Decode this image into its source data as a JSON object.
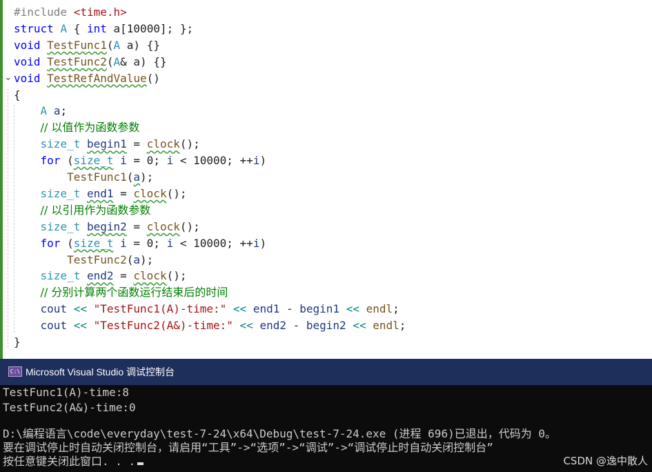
{
  "editor": {
    "lines": [
      {
        "tokens": [
          {
            "t": "#include ",
            "c": "pp"
          },
          {
            "t": "<time.h>",
            "c": "st"
          }
        ]
      },
      {
        "tokens": [
          {
            "t": "struct ",
            "c": "kw"
          },
          {
            "t": "A",
            "c": "ty"
          },
          {
            "t": " { "
          },
          {
            "t": "int",
            "c": "kw"
          },
          {
            "t": " a[10000]; };"
          }
        ]
      },
      {
        "tokens": [
          {
            "t": "void ",
            "c": "kw"
          },
          {
            "t": "TestFunc1",
            "c": "fn sq"
          },
          {
            "t": "("
          },
          {
            "t": "A",
            "c": "ty"
          },
          {
            "t": " a) {}"
          }
        ]
      },
      {
        "tokens": [
          {
            "t": "void ",
            "c": "kw"
          },
          {
            "t": "TestFunc2",
            "c": "fn sq"
          },
          {
            "t": "("
          },
          {
            "t": "A",
            "c": "ty"
          },
          {
            "t": "& a) {}"
          }
        ]
      },
      {
        "tokens": [
          {
            "t": "void ",
            "c": "kw"
          },
          {
            "t": "TestRefAndValue",
            "c": "fn sq"
          },
          {
            "t": "()"
          }
        ]
      },
      {
        "tokens": [
          {
            "t": "{"
          }
        ]
      },
      {
        "tokens": [
          {
            "t": "    "
          },
          {
            "t": "A",
            "c": "ty"
          },
          {
            "t": " "
          },
          {
            "t": "a",
            "c": "vr"
          },
          {
            "t": ";"
          }
        ]
      },
      {
        "tokens": [
          {
            "t": "    "
          },
          {
            "t": "// 以值作为函数参数",
            "c": "cm"
          }
        ]
      },
      {
        "tokens": [
          {
            "t": "    "
          },
          {
            "t": "size_t",
            "c": "ty"
          },
          {
            "t": " "
          },
          {
            "t": "begin1",
            "c": "vr sq"
          },
          {
            "t": " = "
          },
          {
            "t": "clock",
            "c": "fn sq"
          },
          {
            "t": "();"
          }
        ]
      },
      {
        "tokens": [
          {
            "t": "    "
          },
          {
            "t": "for",
            "c": "kw"
          },
          {
            "t": " ("
          },
          {
            "t": "size_t",
            "c": "ty sq"
          },
          {
            "t": " "
          },
          {
            "t": "i",
            "c": "vr"
          },
          {
            "t": " = 0; "
          },
          {
            "t": "i",
            "c": "vr"
          },
          {
            "t": " < 10000; ++"
          },
          {
            "t": "i",
            "c": "vr"
          },
          {
            "t": ")"
          }
        ]
      },
      {
        "tokens": [
          {
            "t": "        "
          },
          {
            "t": "TestFunc1",
            "c": "fn"
          },
          {
            "t": "("
          },
          {
            "t": "a",
            "c": "vr sq"
          },
          {
            "t": ");"
          }
        ]
      },
      {
        "tokens": [
          {
            "t": "    "
          },
          {
            "t": "size_t",
            "c": "ty"
          },
          {
            "t": " "
          },
          {
            "t": "end1",
            "c": "vr sq"
          },
          {
            "t": " = "
          },
          {
            "t": "clock",
            "c": "fn sq"
          },
          {
            "t": "();"
          }
        ]
      },
      {
        "tokens": [
          {
            "t": "    "
          },
          {
            "t": "// 以引用作为函数参数",
            "c": "cm"
          }
        ]
      },
      {
        "tokens": [
          {
            "t": "    "
          },
          {
            "t": "size_t",
            "c": "ty"
          },
          {
            "t": " "
          },
          {
            "t": "begin2",
            "c": "vr sq"
          },
          {
            "t": " = "
          },
          {
            "t": "clock",
            "c": "fn sq"
          },
          {
            "t": "();"
          }
        ]
      },
      {
        "tokens": [
          {
            "t": "    "
          },
          {
            "t": "for",
            "c": "kw"
          },
          {
            "t": " ("
          },
          {
            "t": "size_t",
            "c": "ty sq"
          },
          {
            "t": " "
          },
          {
            "t": "i",
            "c": "vr"
          },
          {
            "t": " = 0; "
          },
          {
            "t": "i",
            "c": "vr"
          },
          {
            "t": " < 10000; ++"
          },
          {
            "t": "i",
            "c": "vr"
          },
          {
            "t": ")"
          }
        ]
      },
      {
        "tokens": [
          {
            "t": "        "
          },
          {
            "t": "TestFunc2",
            "c": "fn"
          },
          {
            "t": "("
          },
          {
            "t": "a",
            "c": "vr"
          },
          {
            "t": ");"
          }
        ]
      },
      {
        "tokens": [
          {
            "t": "    "
          },
          {
            "t": "size_t",
            "c": "ty"
          },
          {
            "t": " "
          },
          {
            "t": "end2",
            "c": "vr sq"
          },
          {
            "t": " = "
          },
          {
            "t": "clock",
            "c": "fn sq"
          },
          {
            "t": "();"
          }
        ]
      },
      {
        "tokens": [
          {
            "t": "    "
          },
          {
            "t": "// 分别计算两个函数运行结束后的时间",
            "c": "cm"
          }
        ]
      },
      {
        "tokens": [
          {
            "t": "    "
          },
          {
            "t": "cout",
            "c": "vr"
          },
          {
            "t": " "
          },
          {
            "t": "<<",
            "c": "op"
          },
          {
            "t": " "
          },
          {
            "t": "\"TestFunc1(A)-time:\"",
            "c": "st"
          },
          {
            "t": " "
          },
          {
            "t": "<<",
            "c": "op"
          },
          {
            "t": " "
          },
          {
            "t": "end1",
            "c": "vr"
          },
          {
            "t": " - "
          },
          {
            "t": "begin1",
            "c": "vr"
          },
          {
            "t": " "
          },
          {
            "t": "<<",
            "c": "op"
          },
          {
            "t": " "
          },
          {
            "t": "endl",
            "c": "fn"
          },
          {
            "t": ";"
          }
        ]
      },
      {
        "tokens": [
          {
            "t": "    "
          },
          {
            "t": "cout",
            "c": "vr"
          },
          {
            "t": " "
          },
          {
            "t": "<<",
            "c": "op"
          },
          {
            "t": " "
          },
          {
            "t": "\"TestFunc2(A&)-time:\"",
            "c": "st"
          },
          {
            "t": " "
          },
          {
            "t": "<<",
            "c": "op"
          },
          {
            "t": " "
          },
          {
            "t": "end2",
            "c": "vr"
          },
          {
            "t": " - "
          },
          {
            "t": "begin2",
            "c": "vr"
          },
          {
            "t": " "
          },
          {
            "t": "<<",
            "c": "op"
          },
          {
            "t": " "
          },
          {
            "t": "endl",
            "c": "fn"
          },
          {
            "t": ";"
          }
        ]
      },
      {
        "tokens": [
          {
            "t": "}"
          }
        ]
      }
    ]
  },
  "console": {
    "title": "Microsoft Visual Studio 调试控制台",
    "icon_glyph": "C:\\",
    "output_lines": [
      "TestFunc1(A)-time:8",
      "TestFunc2(A&)-time:0",
      "",
      "D:\\编程语言\\code\\everyday\\test-7-24\\x64\\Debug\\test-7-24.exe (进程 696)已退出，代码为 0。",
      "要在调试停止时自动关闭控制台，请启用“工具”->“选项”->“调试”->“调试停止时自动关闭控制台”",
      "按任意键关闭此窗口. . ."
    ]
  },
  "watermark": "CSDN @逸中散人"
}
